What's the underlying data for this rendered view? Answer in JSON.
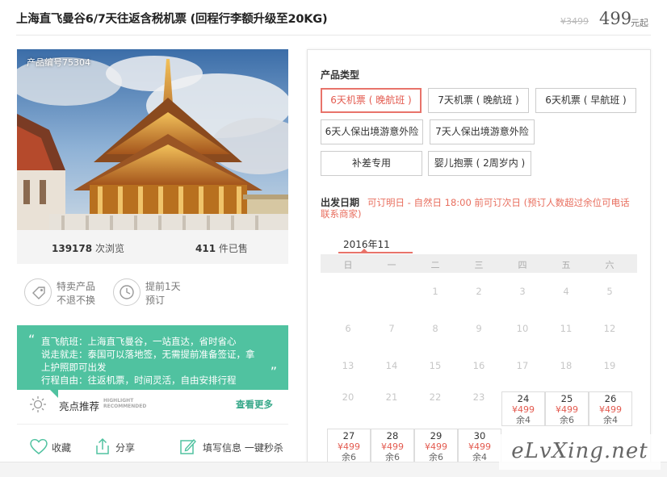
{
  "header": {
    "title": "上海直飞曼谷6/7天往返含税机票 (回程行李额升级至20KG)",
    "old_price": "¥3499",
    "price": "499",
    "price_unit": "元起"
  },
  "product": {
    "product_no": "产品编号75304",
    "views_count": "139178",
    "views_label": "次浏览",
    "sold_count": "411",
    "sold_label": "件已售",
    "features": [
      {
        "line1": "特卖产品",
        "line2": "不退不换",
        "icon": "tag-icon"
      },
      {
        "line1": "提前1天",
        "line2": "预订",
        "icon": "clock-icon"
      }
    ],
    "recommend": {
      "lines": [
        "直飞航班：上海直飞曼谷，一站直达，省时省心",
        "说走就走：泰国可以落地签，无需提前准备签证，拿",
        "上护照即可出发",
        "行程自由：往返机票，时间灵活，自由安排行程"
      ]
    },
    "highlight": {
      "label": "亮点推荐",
      "en_line1": "HIGHLIGHT",
      "en_line2": "RECOMMENDED",
      "more": "查看更多"
    },
    "actions": {
      "favorite": "收藏",
      "share": "分享",
      "fill": "填写信息 一键秒杀"
    }
  },
  "booking": {
    "type_title": "产品类型",
    "types": [
      {
        "label": "6天机票 ( 晚航班 )",
        "selected": true
      },
      {
        "label": "7天机票 ( 晚航班 )",
        "selected": false
      },
      {
        "label": "6天机票 ( 早航班 )",
        "selected": false
      },
      {
        "label": "6天人保出境游意外险",
        "selected": false
      },
      {
        "label": "7天人保出境游意外险",
        "selected": false
      },
      {
        "label": "补差专用",
        "selected": false
      },
      {
        "label": "婴儿抱票 ( 2周岁内 )",
        "selected": false
      }
    ],
    "date_title": "出发日期",
    "date_note": "可订明日 - 自然日 18:00 前可订次日 (预订人数超过余位可电话联系商家)",
    "month": "2016年11",
    "weekdays": [
      "日",
      "一",
      "二",
      "三",
      "四",
      "五",
      "六"
    ],
    "days": [
      {
        "d": "1"
      },
      {
        "d": "2"
      },
      {
        "d": "3"
      },
      {
        "d": "4"
      },
      {
        "d": "5"
      },
      {
        "d": "6"
      },
      {
        "d": "7"
      },
      {
        "d": "8"
      },
      {
        "d": "9"
      },
      {
        "d": "10"
      },
      {
        "d": "11"
      },
      {
        "d": "12"
      },
      {
        "d": "13"
      },
      {
        "d": "14"
      },
      {
        "d": "15"
      },
      {
        "d": "16"
      },
      {
        "d": "17"
      },
      {
        "d": "18"
      },
      {
        "d": "19"
      },
      {
        "d": "20"
      },
      {
        "d": "21"
      },
      {
        "d": "22"
      },
      {
        "d": "23"
      },
      {
        "d": "24",
        "price": "¥499",
        "remain": "余4"
      },
      {
        "d": "25",
        "price": "¥499",
        "remain": "余6"
      },
      {
        "d": "26",
        "price": "¥499",
        "remain": "余4"
      },
      {
        "d": "27",
        "price": "¥499",
        "remain": "余6"
      },
      {
        "d": "28",
        "price": "¥499",
        "remain": "余6"
      },
      {
        "d": "29",
        "price": "¥499",
        "remain": "余6"
      },
      {
        "d": "30",
        "price": "¥499",
        "remain": "余4"
      }
    ]
  },
  "watermark": "eLvXing.net",
  "colors": {
    "accent": "#e8736a",
    "green": "#50c2a0"
  }
}
